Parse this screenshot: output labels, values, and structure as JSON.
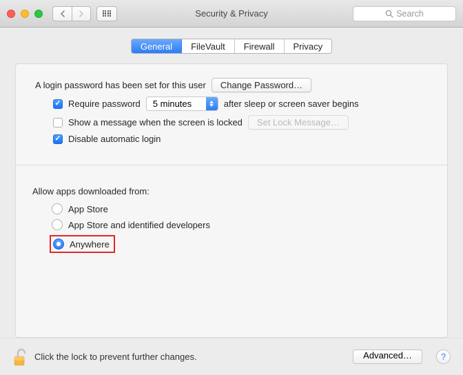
{
  "window": {
    "title": "Security & Privacy",
    "search_placeholder": "Search"
  },
  "tabs": {
    "general": "General",
    "filevault": "FileVault",
    "firewall": "Firewall",
    "privacy": "Privacy"
  },
  "login": {
    "password_set_text": "A login password has been set for this user",
    "change_password_btn": "Change Password…",
    "require_password_label": "Require password",
    "require_password_delay": "5 minutes",
    "require_password_after": "after sleep or screen saver begins",
    "show_message_label": "Show a message when the screen is locked",
    "set_lock_message_btn": "Set Lock Message…",
    "disable_auto_login_label": "Disable automatic login"
  },
  "gatekeeper": {
    "section_label": "Allow apps downloaded from:",
    "options": {
      "appstore": "App Store",
      "identified": "App Store and identified developers",
      "anywhere": "Anywhere"
    },
    "selected": "anywhere"
  },
  "footer": {
    "lock_text": "Click the lock to prevent further changes.",
    "advanced_btn": "Advanced…",
    "help": "?"
  }
}
